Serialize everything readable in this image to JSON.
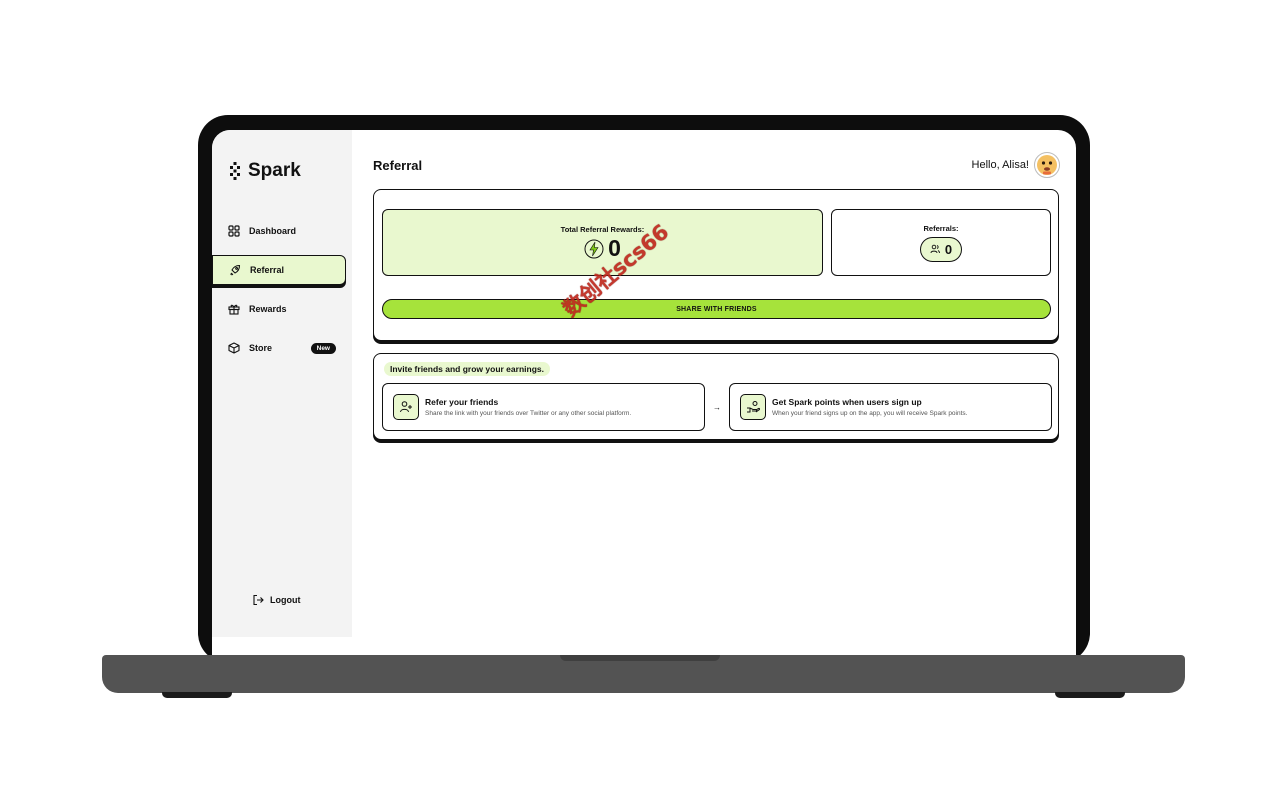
{
  "app": {
    "brand_name": "Spark",
    "logo_icon": "spark-dots-logo"
  },
  "sidebar": {
    "items": [
      {
        "label": "Dashboard",
        "icon": "grid-icon",
        "active": false
      },
      {
        "label": "Referral",
        "icon": "rocket-icon",
        "active": true
      },
      {
        "label": "Rewards",
        "icon": "gift-icon",
        "active": false
      },
      {
        "label": "Store",
        "icon": "box-icon",
        "active": false,
        "badge": "New"
      }
    ],
    "logout_label": "Logout"
  },
  "header": {
    "title": "Referral",
    "greeting": "Hello, Alisa!",
    "avatar": "avatar"
  },
  "stats": {
    "total_rewards_label": "Total Referral Rewards:",
    "total_rewards_value": "0",
    "referrals_label": "Referrals:",
    "referrals_value": "0"
  },
  "share_button_label": "SHARE WITH FRIENDS",
  "invite": {
    "headline": "Invite friends and grow your earnings.",
    "steps": [
      {
        "title": "Refer your friends",
        "description": "Share the link with your friends over Twitter or any other social platform.",
        "icon": "user-plus-icon"
      },
      {
        "title": "Get Spark points when users sign up",
        "description": "When your friend signs up on the app, you will receive Spark points.",
        "icon": "hand-coin-icon"
      }
    ],
    "arrow": "→"
  },
  "watermark": "数创社scs66",
  "colors": {
    "accent_green": "#a6e33b",
    "accent_light": "#e9f8cf",
    "ink": "#111111",
    "sidebar_bg": "#f3f3f3"
  }
}
